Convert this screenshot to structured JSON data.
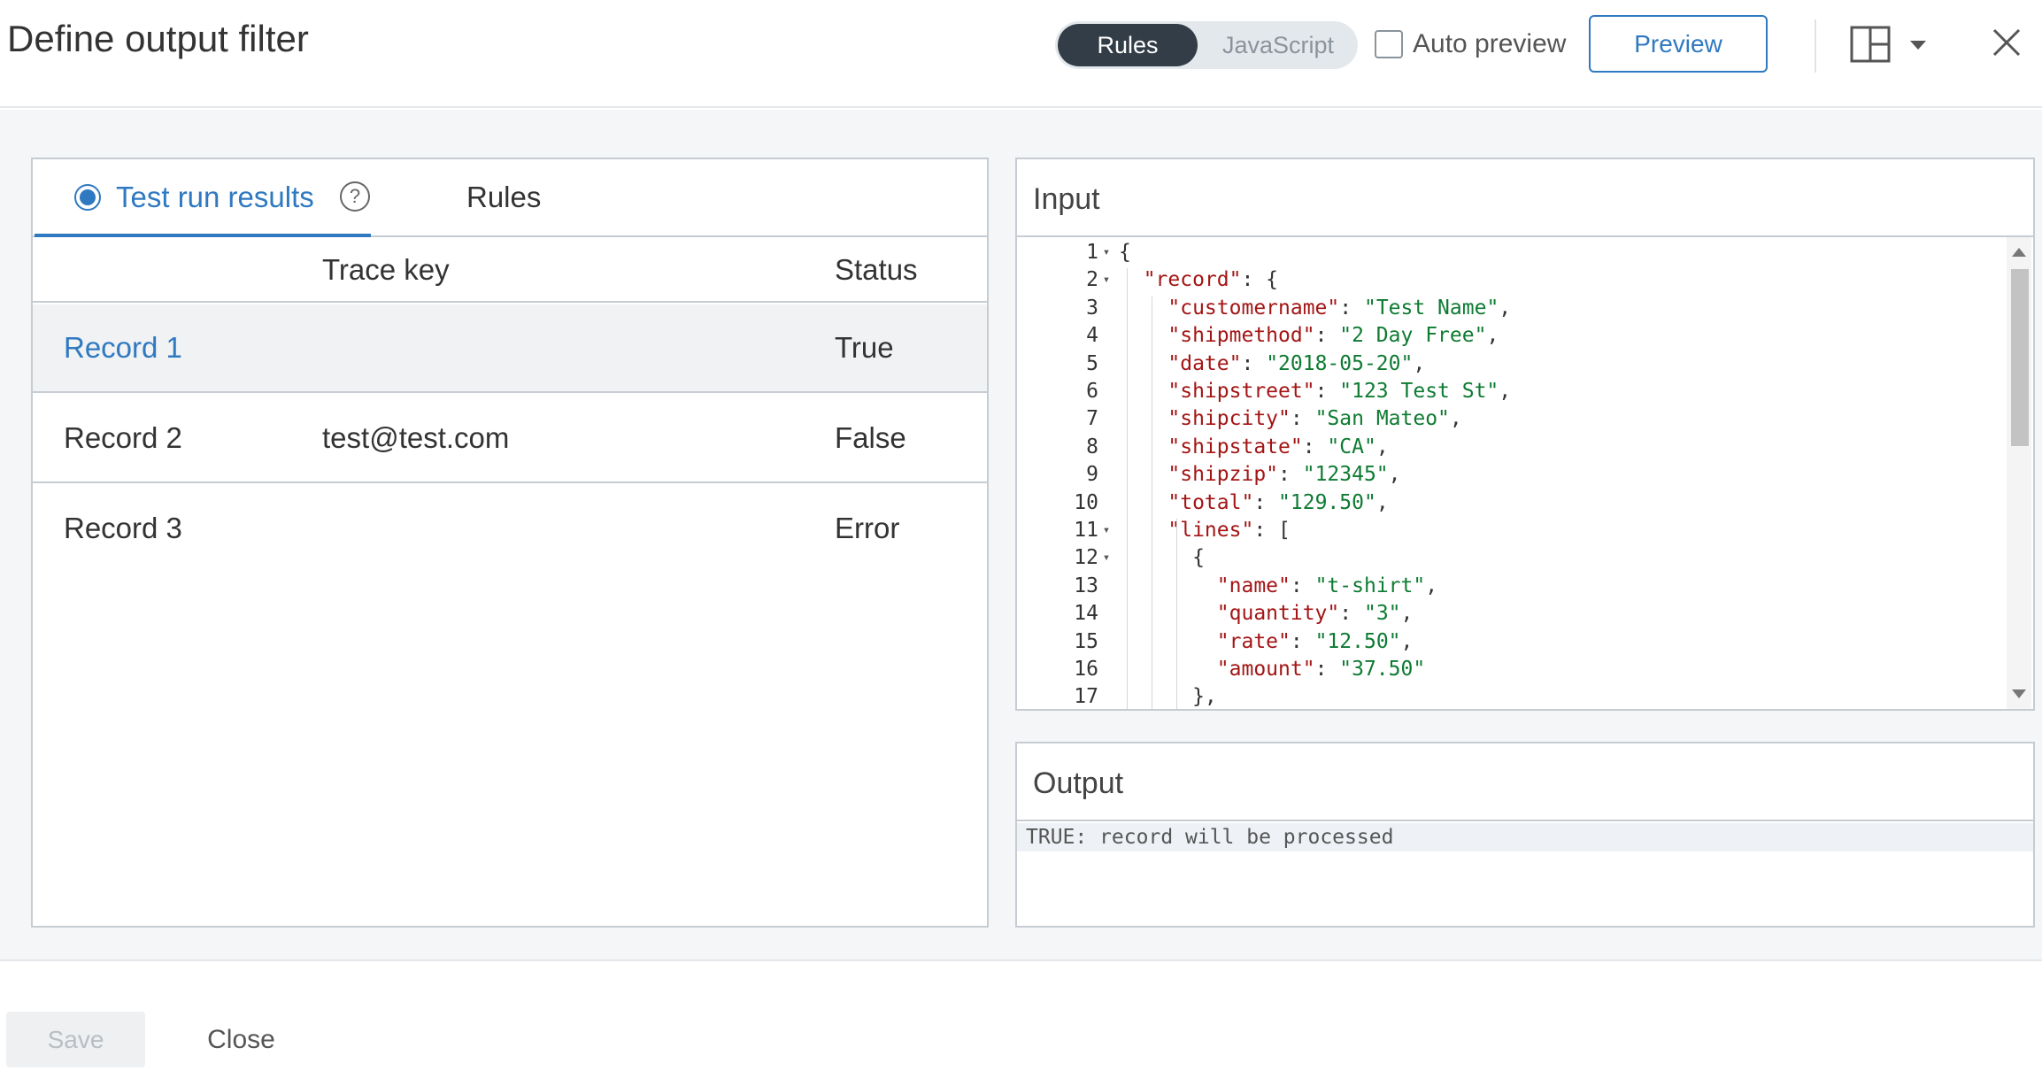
{
  "header": {
    "title": "Define output filter",
    "mode_toggle": [
      "Rules",
      "JavaScript"
    ],
    "auto_preview_label": "Auto preview",
    "preview_label": "Preview"
  },
  "left": {
    "tabs": {
      "active": "Test run results",
      "other": "Rules"
    },
    "columns": {
      "trace_key": "Trace key",
      "status": "Status"
    },
    "records": [
      {
        "name": "Record 1",
        "trace_key": "",
        "status": "True"
      },
      {
        "name": "Record 2",
        "trace_key": "test@test.com",
        "status": "False"
      },
      {
        "name": "Record 3",
        "trace_key": "",
        "status": "Error"
      }
    ]
  },
  "input": {
    "title": "Input",
    "line_numbers": [
      "1",
      "2",
      "3",
      "4",
      "5",
      "6",
      "7",
      "8",
      "9",
      "10",
      "11",
      "12",
      "13",
      "14",
      "15",
      "16",
      "17"
    ],
    "lines": [
      "{",
      "  \"record\": {",
      "    \"customername\": \"Test Name\",",
      "    \"shipmethod\": \"2 Day Free\",",
      "    \"date\": \"2018-05-20\",",
      "    \"shipstreet\": \"123 Test St\",",
      "    \"shipcity\": \"San Mateo\",",
      "    \"shipstate\": \"CA\",",
      "    \"shipzip\": \"12345\",",
      "    \"total\": \"129.50\",",
      "    \"lines\": [",
      "      {",
      "        \"name\": \"t-shirt\",",
      "        \"quantity\": \"3\",",
      "        \"rate\": \"12.50\",",
      "        \"amount\": \"37.50\"",
      "      },"
    ]
  },
  "output": {
    "title": "Output",
    "text": "TRUE: record will be processed"
  },
  "footer": {
    "save_label": "Save",
    "close_label": "Close"
  }
}
